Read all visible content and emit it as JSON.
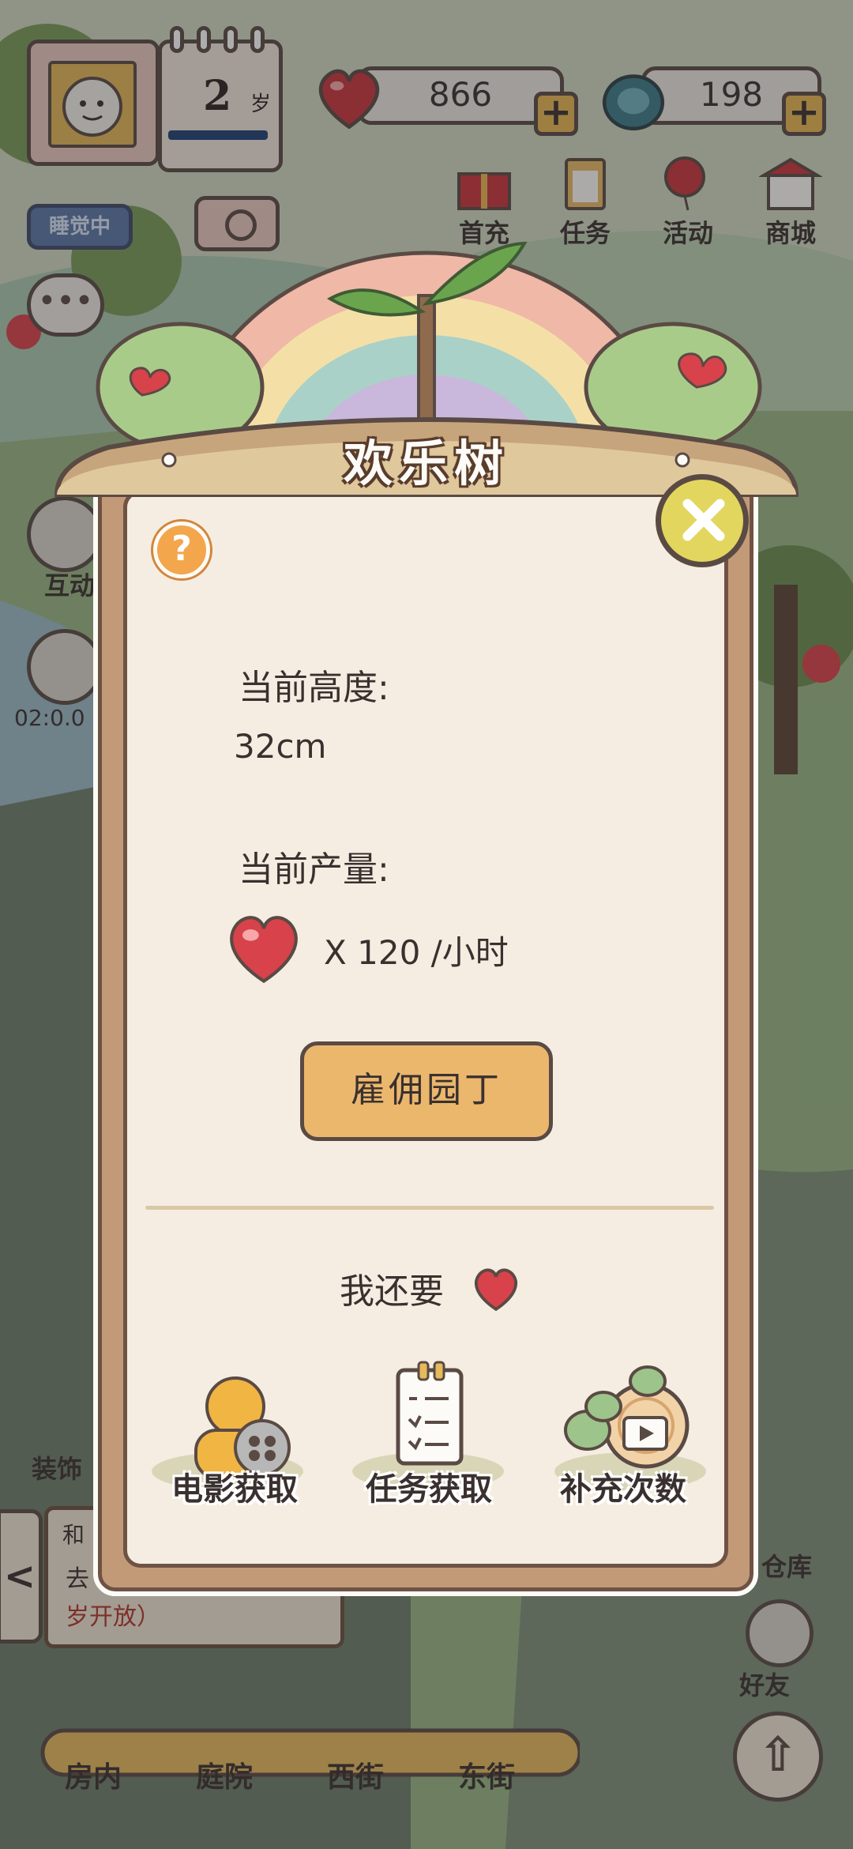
{
  "hud": {
    "age_number": "2",
    "age_unit": "岁",
    "status": "睡觉中",
    "hearts_count": "866",
    "gems_count": "198",
    "plus": "+"
  },
  "top_menu": [
    {
      "label": "首充",
      "icon": "gift-box-icon"
    },
    {
      "label": "任务",
      "icon": "clipboard-icon"
    },
    {
      "label": "活动",
      "icon": "balloon-icon"
    },
    {
      "label": "商城",
      "icon": "shop-awning-icon"
    }
  ],
  "side_left": {
    "interact_label": "互动",
    "timer": "02:0.0",
    "decorate_label": "装饰"
  },
  "side_right": {
    "warehouse_label": "仓库",
    "friends_label": "好友"
  },
  "notice": {
    "title": "和",
    "text": "去",
    "red_text": "岁开放）",
    "back": "<"
  },
  "bottom_nav": [
    {
      "label": "房内"
    },
    {
      "label": "庭院"
    },
    {
      "label": "西街"
    },
    {
      "label": "东街"
    }
  ],
  "modal": {
    "title": "欢乐树",
    "help": "?",
    "height_label": "当前高度:",
    "height_value": "32cm",
    "output_label": "当前产量:",
    "output_value": "X 120 /小时",
    "hire_button": "雇佣园丁",
    "want_more": "我还要",
    "options": [
      {
        "label": "电影获取",
        "icon": "film-reel-icon"
      },
      {
        "label": "任务获取",
        "icon": "checklist-icon"
      },
      {
        "label": "补充次数",
        "icon": "video-refill-icon"
      }
    ]
  },
  "colors": {
    "heart": "#d8424a",
    "gem": "#3d7b88",
    "button": "#ebb76d",
    "close": "#e2d65f",
    "help": "#f3a64c",
    "board": "#c39a78",
    "panel": "#f5ede1"
  }
}
